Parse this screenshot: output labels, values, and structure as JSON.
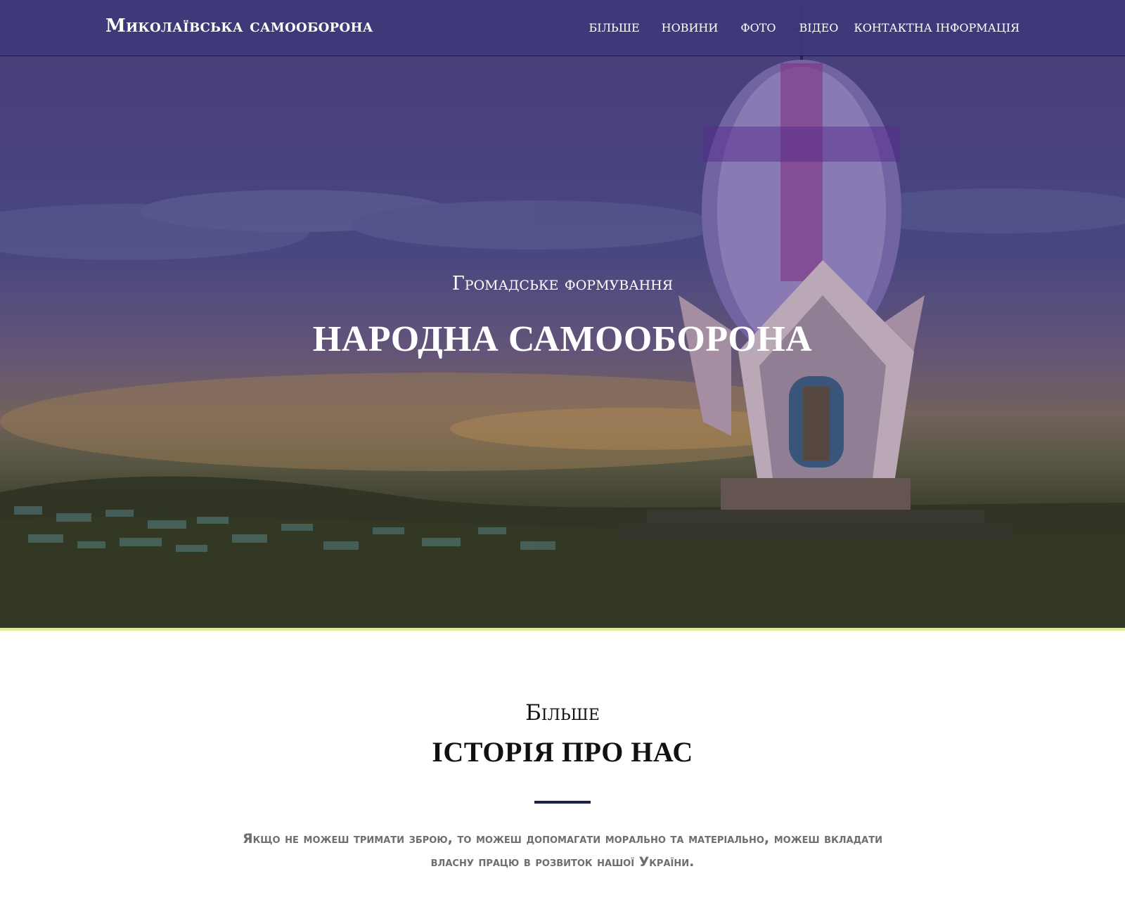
{
  "brand": {
    "name": "Миколаївська самооборона"
  },
  "nav": {
    "items": [
      "БІЛЬШЕ",
      "НОВИНИ",
      "ФОТО",
      "ВІДЕО",
      "КОНТАКТНА ІНФОРМАЦІЯ"
    ]
  },
  "hero": {
    "subtitle": "Громадське формування",
    "title": "НАРОДНА САМООБОРОНА"
  },
  "about": {
    "kicker": "Більше",
    "title": "ІСТОРІЯ ПРО НАС",
    "text": "Якщо не можеш тримати зброю, то можеш допомагати морально та матеріально, можеш вкладати власну працю в розвиток нашої України."
  },
  "colors": {
    "navbar": "#3e3878",
    "hero_accent_line": "#d9ee8a",
    "divider": "#1a2248"
  }
}
